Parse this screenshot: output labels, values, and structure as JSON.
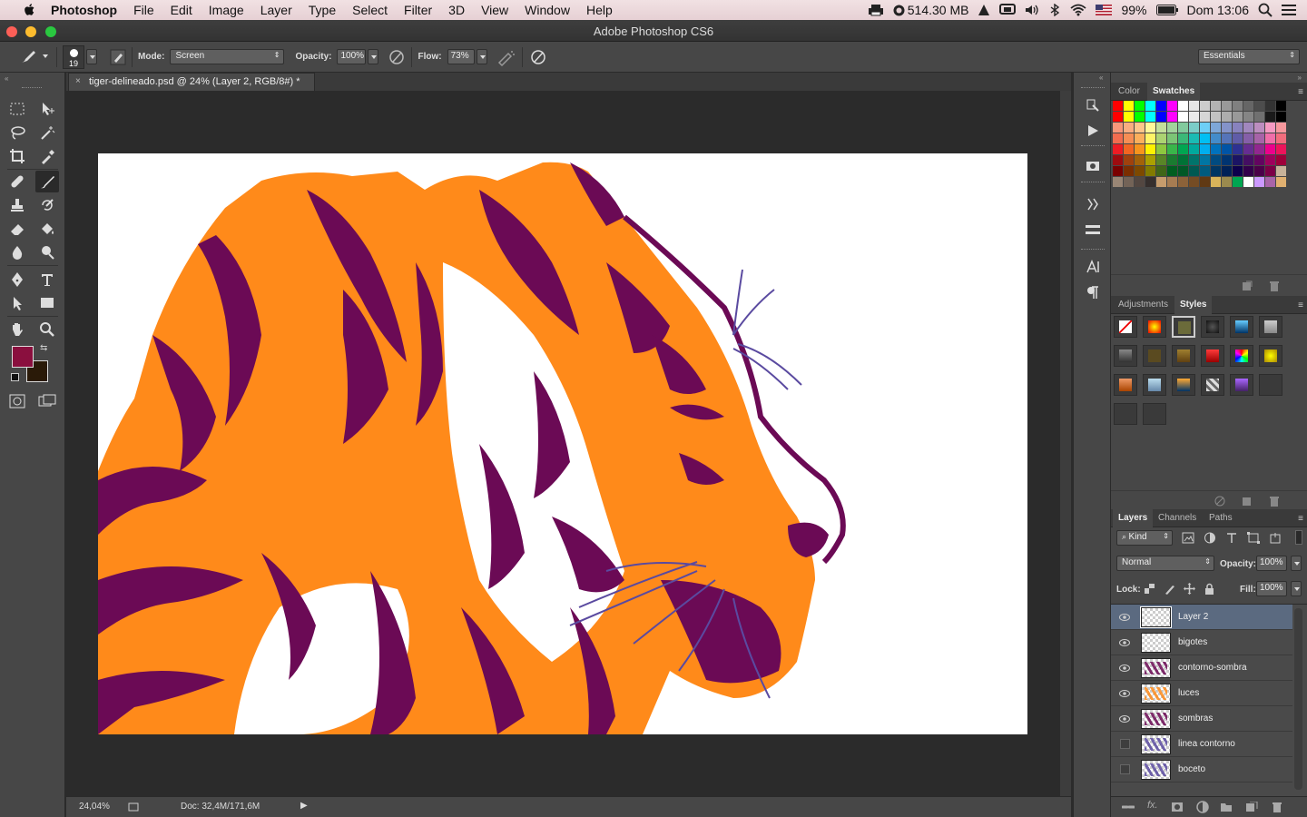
{
  "menubar": {
    "app": "Photoshop",
    "items": [
      "File",
      "Edit",
      "Image",
      "Layer",
      "Type",
      "Select",
      "Filter",
      "3D",
      "View",
      "Window",
      "Help"
    ],
    "memory": "514.30 MB",
    "battery": "99%",
    "clock": "Dom 13:06"
  },
  "window": {
    "title": "Adobe Photoshop CS6"
  },
  "options": {
    "brush_size": "19",
    "mode_label": "Mode:",
    "mode_value": "Screen",
    "opacity_label": "Opacity:",
    "opacity_value": "100%",
    "flow_label": "Flow:",
    "flow_value": "73%",
    "workspace": "Essentials"
  },
  "document": {
    "tab_title": "tiger-delineado.psd @ 24% (Layer 2, RGB/8#) *",
    "zoom": "24,04%",
    "doc_info": "Doc: 32,4M/171,6M"
  },
  "colors": {
    "foreground": "#8a0f3e",
    "background": "#2a1a08",
    "accent_selection": "#5b6a80",
    "tiger_purple": "#6b0a55",
    "tiger_orange": "#ff8a1a",
    "whisker": "#5a4aa0"
  },
  "panels": {
    "color_tabs": [
      "Color",
      "Swatches"
    ],
    "style_tabs": [
      "Adjustments",
      "Styles"
    ],
    "layer_tabs": [
      "Layers",
      "Channels",
      "Paths"
    ],
    "kind_label": "Kind",
    "blend_mode": "Normal",
    "opacity_label": "Opacity:",
    "opacity_value": "100%",
    "lock_label": "Lock:",
    "fill_label": "Fill:",
    "fill_value": "100%"
  },
  "layers": [
    {
      "name": "Layer 2",
      "visible": true,
      "selected": true
    },
    {
      "name": "bigotes",
      "visible": true,
      "selected": false
    },
    {
      "name": "contorno-sombra",
      "visible": true,
      "selected": false
    },
    {
      "name": "luces",
      "visible": true,
      "selected": false
    },
    {
      "name": "sombras",
      "visible": true,
      "selected": false
    },
    {
      "name": "linea contorno",
      "visible": false,
      "selected": false
    },
    {
      "name": "boceto",
      "visible": false,
      "selected": false
    }
  ]
}
